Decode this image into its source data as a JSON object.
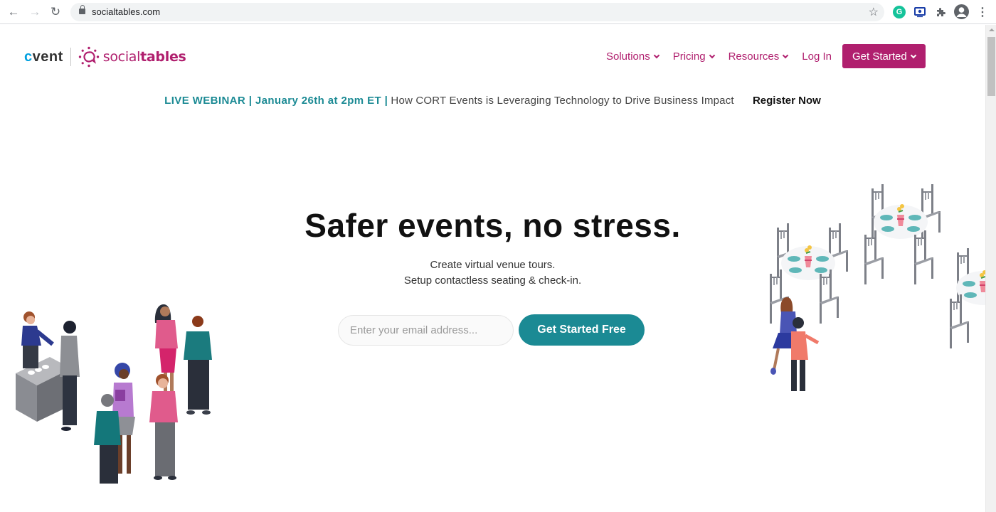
{
  "browser": {
    "url": "socialtables.com",
    "back_icon": "arrow-left-icon",
    "forward_icon": "arrow-right-icon",
    "reload_icon": "reload-icon",
    "extensions": [
      "grammarly-icon",
      "screen-share-icon",
      "puzzle-icon",
      "profile-icon",
      "menu-icon"
    ]
  },
  "logo": {
    "brand_c": "c",
    "brand_rest": "vent",
    "product_regular": "social",
    "product_bold": "tables"
  },
  "nav": {
    "items": [
      {
        "label": "Solutions"
      },
      {
        "label": "Pricing"
      },
      {
        "label": "Resources"
      }
    ],
    "login": "Log In",
    "get_started": "Get Started"
  },
  "banner": {
    "highlight": "LIVE WEBINAR | January 26th at 2pm ET |",
    "text": "How CORT Events is Leveraging Technology to Drive Business Impact",
    "cta": "Register Now"
  },
  "hero": {
    "title": "Safer events, no stress.",
    "subtitle_line1": "Create virtual venue tours.",
    "subtitle_line2": "Setup contactless seating & check-in.",
    "email_placeholder": "Enter your email address...",
    "email_value": "",
    "cta": "Get Started Free"
  },
  "colors": {
    "brand_magenta": "#b01f6e",
    "teal": "#1b8a94",
    "cvent_blue": "#00a0df"
  }
}
